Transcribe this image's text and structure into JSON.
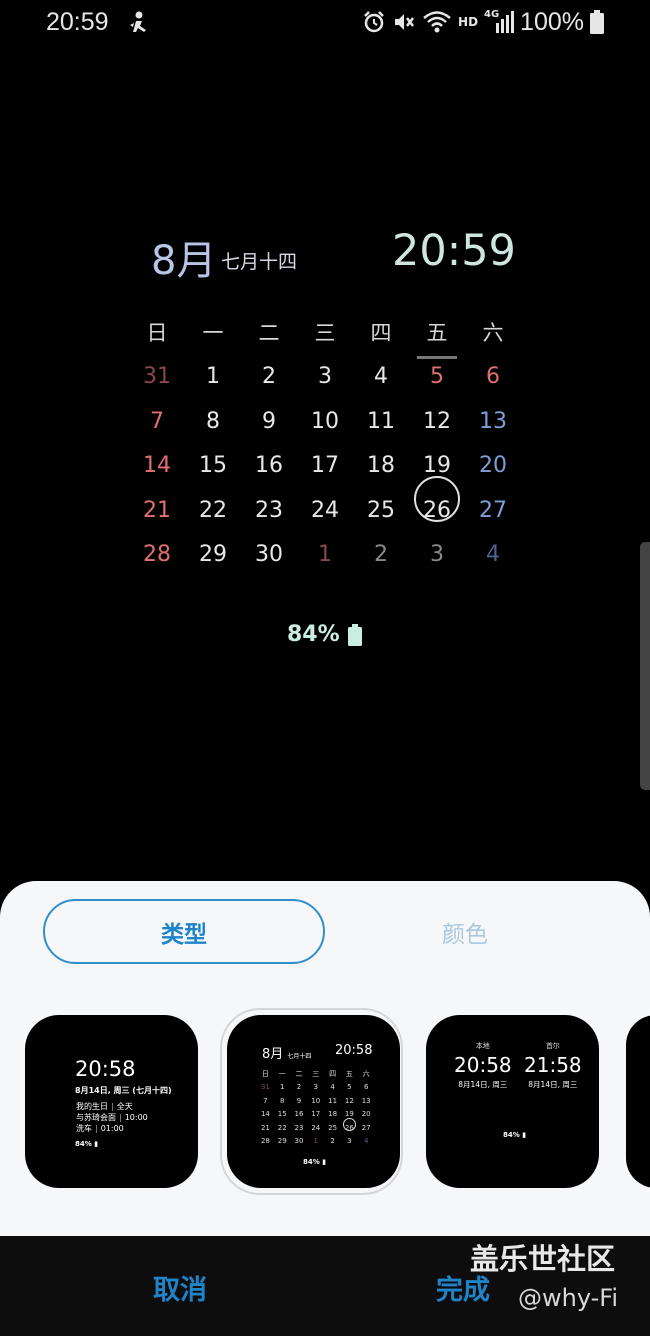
{
  "status_bar": {
    "time": "20:59",
    "battery_text": "100%",
    "hd_label": "HD",
    "net_label": "4G",
    "icons": [
      "person-notify-icon",
      "alarm-icon",
      "mute-icon",
      "wifi-icon",
      "signal-icon",
      "battery-icon"
    ]
  },
  "clock": {
    "month": "8月",
    "lunar": "七月十四",
    "time": "20:59"
  },
  "calendar": {
    "weekdays": [
      "日",
      "一",
      "二",
      "三",
      "四",
      "五",
      "六"
    ],
    "weeks": [
      [
        "31",
        "1",
        "2",
        "3",
        "4",
        "5",
        "6"
      ],
      [
        "7",
        "8",
        "9",
        "10",
        "11",
        "12",
        "13"
      ],
      [
        "14",
        "15",
        "16",
        "17",
        "18",
        "19",
        "20"
      ],
      [
        "21",
        "22",
        "23",
        "24",
        "25",
        "26",
        "27"
      ],
      [
        "28",
        "29",
        "30",
        "1",
        "2",
        "3",
        "4"
      ]
    ],
    "today": "26"
  },
  "battery": {
    "level_text": "84%"
  },
  "sheet": {
    "tabs": {
      "type_label": "类型",
      "color_label": "颜色"
    },
    "thumb1": {
      "time": "20:58",
      "date": "8月14日, 周三 (七月十四)",
      "events": [
        {
          "name": "我的生日",
          "time": "全天"
        },
        {
          "name": "与苏琦会面",
          "time": "10:00"
        },
        {
          "name": "洗车",
          "time": "01:00"
        }
      ],
      "battery": "84%"
    },
    "thumb2": {
      "month": "8月",
      "lunar": "七月十四",
      "time": "20:58",
      "weekdays": [
        "日",
        "一",
        "二",
        "三",
        "四",
        "五",
        "六"
      ],
      "weeks": [
        [
          "31",
          "1",
          "2",
          "3",
          "4",
          "5",
          "6"
        ],
        [
          "7",
          "8",
          "9",
          "10",
          "11",
          "12",
          "13"
        ],
        [
          "14",
          "15",
          "16",
          "17",
          "18",
          "19",
          "20"
        ],
        [
          "21",
          "22",
          "23",
          "24",
          "25",
          "26",
          "27"
        ],
        [
          "28",
          "29",
          "30",
          "1",
          "2",
          "3",
          "4"
        ]
      ],
      "battery": "84%"
    },
    "thumb3": {
      "local_label": "本地",
      "local_time": "20:58",
      "local_date": "8月14日, 周三",
      "seoul_label": "首尔",
      "seoul_time": "21:58",
      "seoul_date": "8月14日, 周三",
      "battery": "84%"
    }
  },
  "bottom": {
    "cancel_label": "取消",
    "done_label": "完成"
  },
  "watermark": {
    "line1": "盖乐世社区",
    "line2": "@why-Fi"
  },
  "colors": {
    "accent": "#1f84c9",
    "sunday": "#e07070",
    "saturday": "#7f9ed8",
    "battery_green": "#c9ede1"
  }
}
